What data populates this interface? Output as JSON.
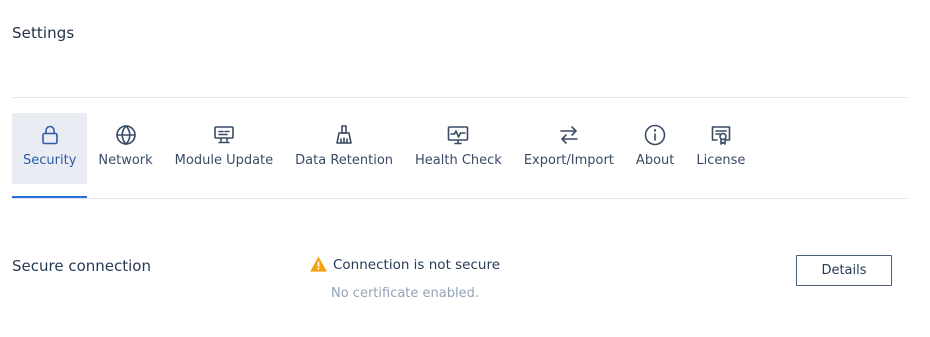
{
  "page": {
    "title": "Settings"
  },
  "tabs": [
    {
      "label": "Security",
      "icon": "lock-icon",
      "active": true
    },
    {
      "label": "Network",
      "icon": "globe-icon",
      "active": false
    },
    {
      "label": "Module Update",
      "icon": "module-update-icon",
      "active": false
    },
    {
      "label": "Data Retention",
      "icon": "broom-icon",
      "active": false
    },
    {
      "label": "Health Check",
      "icon": "monitor-pulse-icon",
      "active": false
    },
    {
      "label": "Export/Import",
      "icon": "arrows-swap-icon",
      "active": false
    },
    {
      "label": "About",
      "icon": "info-icon",
      "active": false
    },
    {
      "label": "License",
      "icon": "certificate-icon",
      "active": false
    }
  ],
  "security": {
    "section_label": "Secure connection",
    "status_title": "Connection is not secure",
    "status_subtitle": "No certificate enabled.",
    "details_label": "Details"
  },
  "colors": {
    "accent": "#2c6fd6",
    "warning": "#f2a30f",
    "text": "#273a56",
    "muted": "#93a3b8",
    "active_tab_bg": "#e9edf3"
  }
}
